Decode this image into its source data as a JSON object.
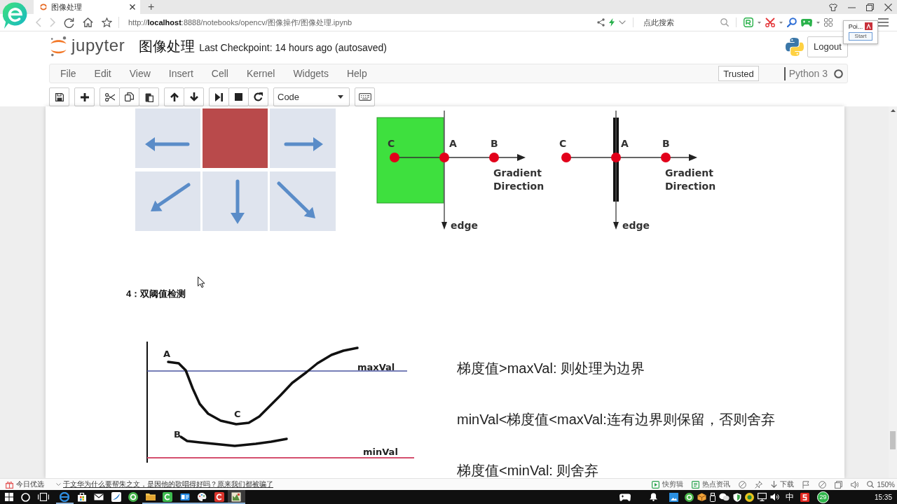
{
  "browser": {
    "tabs": [
      {
        "title": "图像处理",
        "selected": true
      }
    ],
    "new_tab": "+",
    "url": "http://**localhost**:8888/notebooks/opencv/图像操作/图像处理.ipynb",
    "search": {
      "placeholder": "点此搜索"
    },
    "popup": {
      "title": "Poi...",
      "button": "Start"
    }
  },
  "header": {
    "logo_text": "jupyter",
    "title": "图像处理",
    "checkpoint": "Last Checkpoint: 14 hours ago (autosaved)",
    "logout": "Logout"
  },
  "menu": {
    "items": [
      "File",
      "Edit",
      "View",
      "Insert",
      "Cell",
      "Kernel",
      "Widgets",
      "Help"
    ],
    "trusted": "Trusted",
    "kernel": "Python 3",
    "kernel_busy": false
  },
  "toolbar": {
    "cell_type": "Code"
  },
  "notebook": {
    "gradient_diagrams": [
      {
        "kind": "region",
        "points": [
          "C",
          "A",
          "B"
        ],
        "direction": "Gradient Direction",
        "edge": "edge"
      },
      {
        "kind": "line",
        "points": [
          "C",
          "A",
          "B"
        ],
        "direction": "Gradient Direction",
        "edge": "edge"
      }
    ],
    "heading": "4：双阈值检测",
    "threshold_diagram": {
      "curve_labels": [
        "A",
        "C",
        "B"
      ],
      "max_line": "maxVal",
      "min_line": "minVal"
    },
    "rules": [
      "梯度值>maxVal: 则处理为边界",
      "minVal<梯度值<maxVal:连有边界则保留，否则舍弃",
      "梯度值<minVal: 则舍弃"
    ]
  },
  "status_bar": {
    "feed": "今日优选",
    "headline": "于文华为什么要帮朱之文，是因他的歌唱得好吗？原来我们都被骗了",
    "tools": [
      {
        "kind": "clip",
        "label": "快剪辑"
      },
      {
        "kind": "news",
        "label": "热点资讯"
      },
      {
        "kind": "download",
        "label": "下载"
      }
    ],
    "zoom": "150%"
  },
  "taskbar": {
    "apps": [
      {
        "running": true,
        "selected": false
      },
      {
        "running": false,
        "selected": false
      },
      {
        "running": false,
        "selected": false
      },
      {
        "running": false,
        "selected": false
      },
      {
        "running": false,
        "selected": false
      },
      {
        "running": true,
        "selected": false
      },
      {
        "running": true,
        "selected": false
      },
      {
        "running": true,
        "selected": false
      },
      {
        "running": true,
        "selected": false
      },
      {
        "running": true,
        "selected": false
      },
      {
        "running": true,
        "selected": true
      }
    ],
    "ime": "中",
    "badge": "29",
    "clock": "15:35"
  }
}
